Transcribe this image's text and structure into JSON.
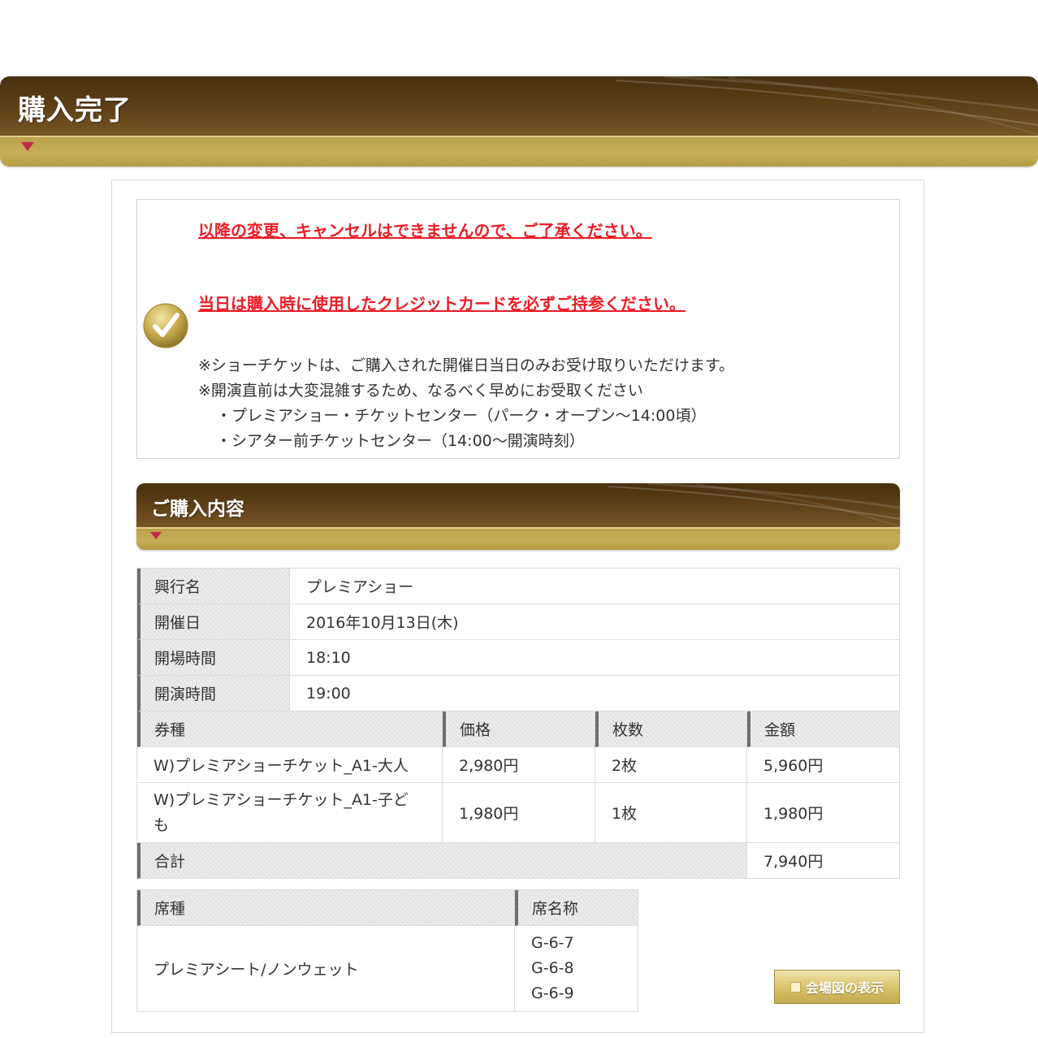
{
  "page": {
    "title": "購入完了"
  },
  "notice": {
    "warnings": [
      "以降の変更、キャンセルはできませんので、ご了承ください。",
      "当日は購入時に使用したクレジットカードを必ずご持参ください。"
    ],
    "notes": [
      "※ショーチケットは、ご購入された開催日当日のみお受け取りいただけます。",
      "※開演直前は大変混雑するため、なるべく早めにお受取ください",
      "・プレミアショー・チケットセンター（パーク・オープン〜14:00頃）",
      "・シアター前チケットセンター（14:00〜開演時刻）"
    ]
  },
  "section": {
    "title": "ご購入内容"
  },
  "info": {
    "rows": [
      {
        "label": "興行名",
        "value": "プレミアショー"
      },
      {
        "label": "開催日",
        "value": "2016年10月13日(木)"
      },
      {
        "label": "開場時間",
        "value": "18:10"
      },
      {
        "label": "開演時間",
        "value": "19:00"
      }
    ]
  },
  "tickets": {
    "headers": [
      "券種",
      "価格",
      "枚数",
      "金額"
    ],
    "rows": [
      {
        "type": "W)プレミアショーチケット_A1-大人",
        "price": "2,980円",
        "count": "2枚",
        "amount": "5,960円"
      },
      {
        "type_line1": "W)プレミアショーチケット_A1-子ど",
        "type_line2": "も",
        "price": "1,980円",
        "count": "1枚",
        "amount": "1,980円"
      }
    ],
    "total_label": "合計",
    "total_value": "7,940円"
  },
  "seats": {
    "headers": [
      "席種",
      "席名称"
    ],
    "seat_type": "プレミアシート/ノンウェット",
    "seat_names": [
      "G-6-7",
      "G-6-8",
      "G-6-9"
    ]
  },
  "map_button": {
    "label": "会場図の表示"
  },
  "colors": {
    "header_brown": "#5c3d15",
    "header_gold": "#c7ae57",
    "warning_red": "#ee1c25",
    "marker_red": "#c0294a"
  }
}
